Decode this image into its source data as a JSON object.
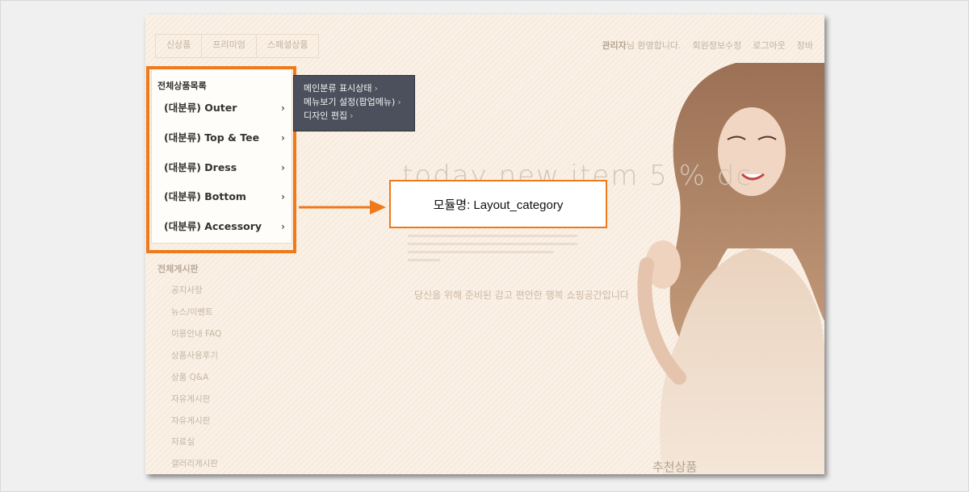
{
  "top_nav": [
    "신상품",
    "프리미엄",
    "스페셜상품"
  ],
  "top_links": {
    "admin": "관리자",
    "welcome": "님 환영합니다.",
    "profile": "회원정보수정",
    "logout": "로그아웃",
    "cart": "장바"
  },
  "category": {
    "title": "전체상품목록",
    "items": [
      "(대분류) Outer",
      "(대분류) Top & Tee",
      "(대분류) Dress",
      "(대분류) Bottom",
      "(대분류) Accessory"
    ],
    "chevron": "›"
  },
  "popup": [
    {
      "label": "메인분류 표시상태",
      "arrow": "›"
    },
    {
      "label": "메뉴보기 설정(팝업메뉴)",
      "arrow": "›"
    },
    {
      "label": "디자인 편집",
      "arrow": "›"
    }
  ],
  "board": {
    "title": "전체게시판",
    "items": [
      "공지사항",
      "뉴스/이벤트",
      "이용안내 FAQ",
      "상품사용후기",
      "상품 Q&A",
      "자유게시판",
      "자유게시판",
      "자료실",
      "갤러리게시판"
    ]
  },
  "hero": {
    "headline": "today new item 5 % dc",
    "subtext": "당신을 위해 준비된 감고 편안한 행복 쇼핑공간입니다",
    "recommend": "추천상품"
  },
  "callout": {
    "label": "모듈명: Layout_category",
    "color": "#ee7a1c"
  },
  "colors": {
    "accent": "#ee7a1c",
    "popup_bg": "#4b505c",
    "page_bg": "#f7ebdd"
  }
}
